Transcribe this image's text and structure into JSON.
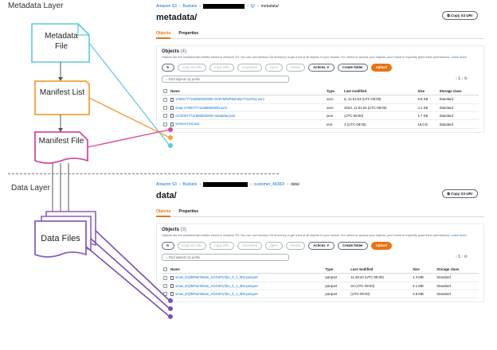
{
  "diagram": {
    "metadata_layer_label": "Metadata Layer",
    "data_layer_label": "Data Layer",
    "metadata_file_label": "Metadata File",
    "manifest_list_label": "Manifest List",
    "manifest_file_label": "Manifest File",
    "data_files_label": "Data Files",
    "colors": {
      "metadata_file": "#5bc8dc",
      "manifest_list": "#f5a03c",
      "manifest_file": "#d94b9b",
      "data_files": "#8b5fbf",
      "connector_metadata": "#5bc8dc",
      "connector_list": "#f5a03c",
      "connector_manifest": "#d94b9b",
      "connector_data": "#7a4fb5"
    }
  },
  "metadata_panel": {
    "crumbs": [
      "Amazon S3",
      "Buckets",
      "metadata/"
    ],
    "crumb_fragment": "Q/",
    "title": "metadata/",
    "copy_uri": "Copy S3 URI",
    "tabs": [
      "Objects",
      "Properties"
    ],
    "objects_heading": "Objects",
    "objects_count": "(4)",
    "description": "Objects are the fundamental entities stored in Amazon S3. You can use Amazon S3 inventory to get a list of all objects in your bucket. For others to access your objects, you'll need to explicitly grant them permissions.",
    "learn_more": "Learn more",
    "buttons": [
      "Copy S3 URI",
      "Copy URL",
      "Download",
      "Open",
      "Delete",
      "Actions ▼",
      "Create folder",
      "Upload"
    ],
    "search_placeholder": "Find objects by prefix",
    "page_number": "1",
    "columns": [
      "Name",
      "Type",
      "Last modified",
      "Size",
      "Storage class"
    ],
    "rows": [
      {
        "name": "17600777150850000000-3V8YMNtP8yfABy77ryi2OQ.avro",
        "type": "avro",
        "modified": "5, 11:51:53 (UTC-08:00)",
        "size": "6.8 KB",
        "storage": "Standard"
      },
      {
        "name": "snap-1700077711668006000.avro",
        "type": "avro",
        "modified": "2023, 11:51:53 (UTC-08:00)",
        "size": "4.1 KB",
        "storage": "Standard"
      },
      {
        "name": "v1700077711685000000.metadata.json",
        "type": "json",
        "modified": "(UTC-08:00)",
        "size": "1.7 KB",
        "storage": "Standard"
      },
      {
        "name": "version-hint.text",
        "type": "text",
        "modified": "3 (UTC-08:00)",
        "size": "19.0 B",
        "storage": "Standard"
      }
    ]
  },
  "data_panel": {
    "crumbs": [
      "Amazon S3",
      "Buckets",
      "customer_46382/",
      "data/"
    ],
    "title": "data/",
    "copy_uri": "Copy S3 URI",
    "tabs": [
      "Objects",
      "Properties"
    ],
    "objects_heading": "Objects",
    "objects_count": "(3)",
    "description": "Objects are the fundamental entities stored in Amazon S3. You can use Amazon S3 inventory to get a list of all objects in your bucket. For others to access your objects, you'll need to explicitly grant them permissions.",
    "learn_more": "Learn more",
    "buttons": [
      "Copy S3 URI",
      "Copy URL",
      "Download",
      "Open",
      "Delete",
      "Actions ▼",
      "Create folder",
      "Upload"
    ],
    "search_placeholder": "Find objects by prefix",
    "page_number": "1",
    "columns": [
      "Name",
      "Type",
      "Last modified",
      "Size",
      "Storage class"
    ],
    "rows": [
      {
        "name": "snow_EQlbRwmh62w_AGO4Fy7jkc_0_1_002.parquet",
        "type": "parquet",
        "modified": "11:48:34 (UTC-08:00)",
        "size": "1.4 MB",
        "storage": "Standard"
      },
      {
        "name": "snow_EQlbRwmh62w_AGO4Fy7jkc_0_1_004.parquet",
        "type": "parquet",
        "modified": "34 (UTC-08:00)",
        "size": "2.1 MB",
        "storage": "Standard"
      },
      {
        "name": "snow_EQlbRwmh62w_AGO4Fy7jkc_0_1_006.parquet",
        "type": "parquet",
        "modified": "(UTC-08:00)",
        "size": "3.6 MB",
        "storage": "Standard"
      }
    ]
  }
}
